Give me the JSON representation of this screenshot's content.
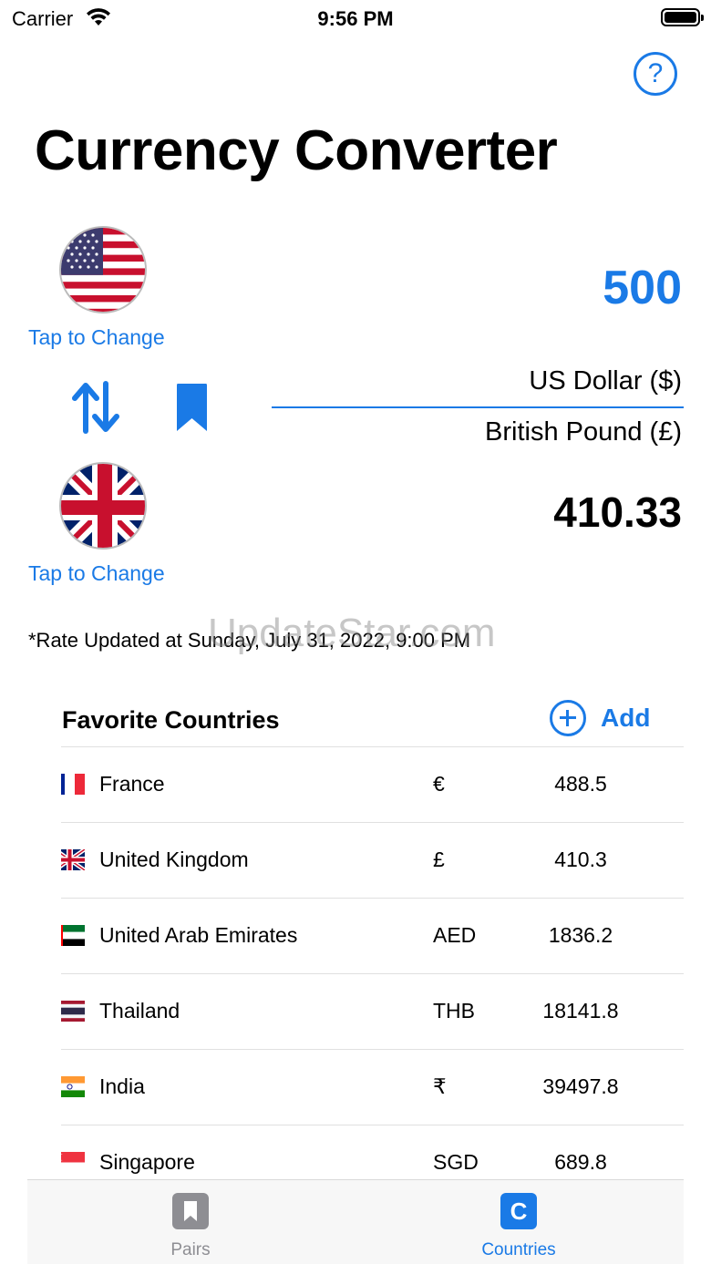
{
  "status_bar": {
    "carrier": "Carrier",
    "time": "9:56 PM"
  },
  "header": {
    "title": "Currency Converter"
  },
  "converter": {
    "amount": "500",
    "from_currency": "US Dollar ($)",
    "to_currency": "British Pound (£)",
    "result": "410.33",
    "tap_to_change_from": "Tap to Change",
    "tap_to_change_to": "Tap to Change",
    "rate_updated": "*Rate Updated at Sunday, July 31, 2022, 9:00 PM"
  },
  "watermark": "UpdateStar.com",
  "favorites": {
    "header": "Favorite Countries",
    "add_label": "Add",
    "rows": [
      {
        "country": "France",
        "symbol": "€",
        "value": "488.5"
      },
      {
        "country": "United Kingdom",
        "symbol": "£",
        "value": "410.3"
      },
      {
        "country": "United Arab Emirates",
        "symbol": "AED",
        "value": "1836.2"
      },
      {
        "country": "Thailand",
        "symbol": "THB",
        "value": "18141.8"
      },
      {
        "country": "India",
        "symbol": "₹",
        "value": "39497.8"
      },
      {
        "country": "Singapore",
        "symbol": "SGD",
        "value": "689.8"
      }
    ]
  },
  "tabbar": {
    "pairs_label": "Pairs",
    "countries_label": "Countries",
    "countries_icon_letter": "C"
  },
  "colors": {
    "accent": "#1a7ae6",
    "inactive": "#8e8e93"
  }
}
